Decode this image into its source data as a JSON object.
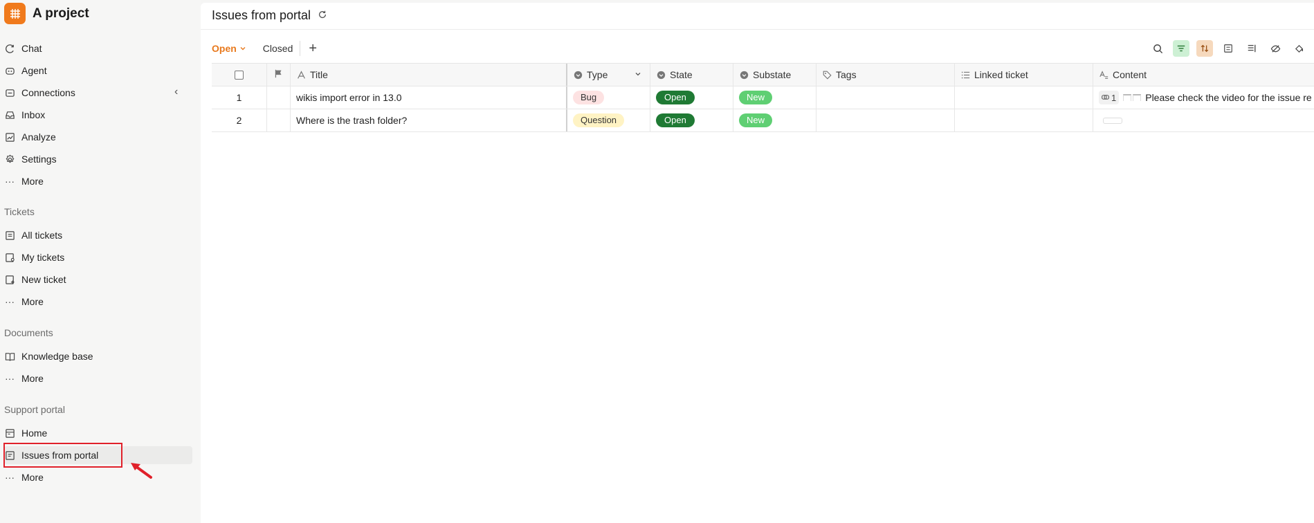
{
  "sidebar": {
    "project_name": "A project",
    "main_items": [
      {
        "label": "Chat",
        "icon": "chat-icon"
      },
      {
        "label": "Agent",
        "icon": "agent-icon"
      },
      {
        "label": "Connections",
        "icon": "connections-icon"
      },
      {
        "label": "Inbox",
        "icon": "inbox-icon"
      },
      {
        "label": "Analyze",
        "icon": "analyze-icon"
      },
      {
        "label": "Settings",
        "icon": "gear-icon"
      },
      {
        "label": "More",
        "icon": "more-icon"
      }
    ],
    "tickets": {
      "label": "Tickets",
      "items": [
        {
          "label": "All tickets"
        },
        {
          "label": "My tickets"
        },
        {
          "label": "New ticket"
        },
        {
          "label": "More"
        }
      ]
    },
    "documents": {
      "label": "Documents",
      "items": [
        {
          "label": "Knowledge base"
        },
        {
          "label": "More"
        }
      ]
    },
    "support_portal": {
      "label": "Support portal",
      "items": [
        {
          "label": "Home"
        },
        {
          "label": "Issues from portal",
          "active": true
        },
        {
          "label": "More"
        }
      ]
    }
  },
  "header": {
    "title": "Issues from portal"
  },
  "filters": {
    "open_label": "Open",
    "closed_label": "Closed"
  },
  "table": {
    "columns": {
      "title": "Title",
      "type": "Type",
      "state": "State",
      "substate": "Substate",
      "tags": "Tags",
      "linked": "Linked ticket",
      "content": "Content"
    },
    "rows": [
      {
        "num": "1",
        "title": "wikis import error in 13.0",
        "type": "Bug",
        "state": "Open",
        "substate": "New",
        "tags": "",
        "linked": "",
        "content_count": "1",
        "content_text": "Please check the video for the issue re"
      },
      {
        "num": "2",
        "title": "Where is the trash folder?",
        "type": "Question",
        "state": "Open",
        "substate": "New",
        "tags": "",
        "linked": "",
        "content_count": "",
        "content_text": ""
      }
    ]
  },
  "colors": {
    "accent": "#f07a1c",
    "open_state": "#1f7a34",
    "new_substate": "#5fcf73",
    "highlight": "#e0202a"
  }
}
